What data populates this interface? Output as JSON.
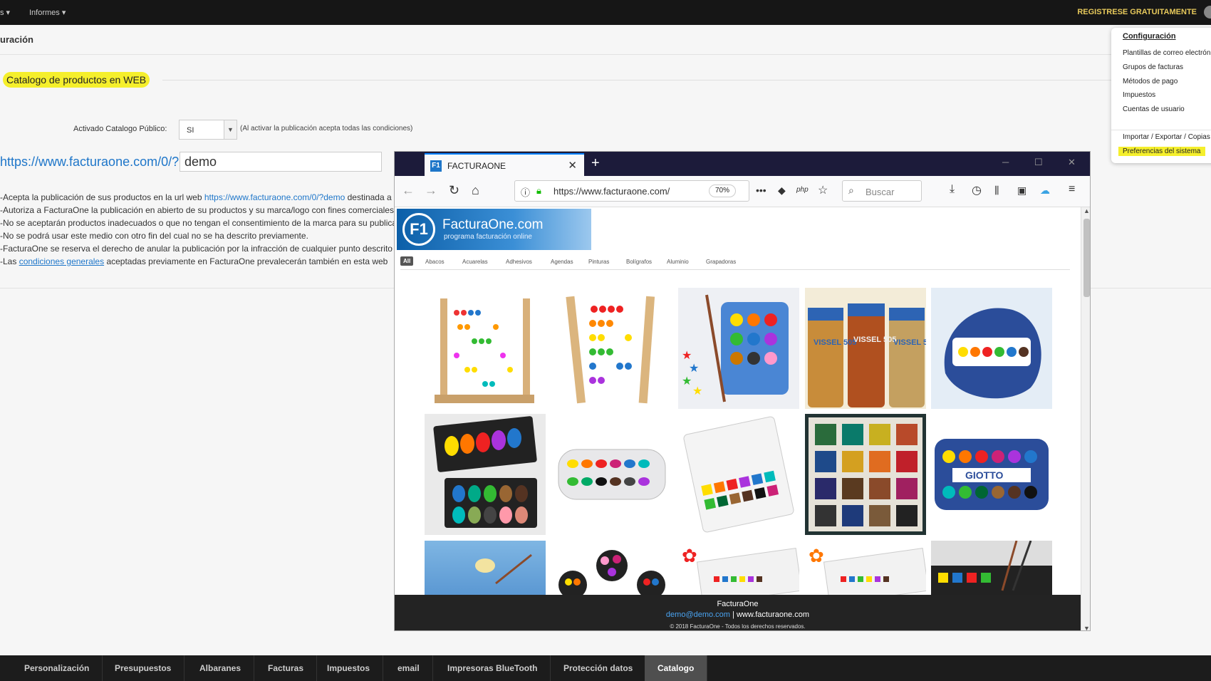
{
  "topbar": {
    "menu_left": "s ▾",
    "menu_informes": "Informes ▾",
    "register": "REGISTRESE GRATUITAMENTE"
  },
  "page": {
    "heading": "uración"
  },
  "catalog": {
    "title": "Catalogo de productos en WEB",
    "activado_label": "Activado Catalogo Público:",
    "activado_value": "SI",
    "activado_note": "(Al activar la publicación acepta todas las condiciones)",
    "url_prefix": "https://www.facturaone.com/0/?",
    "slug": "demo"
  },
  "terms": {
    "l1_pre": "-Acepta la publicación de sus productos en la url web ",
    "l1_link": "https://www.facturaone.com/0/?demo",
    "l1_post": " destinada a la publicación de su catálogo",
    "l2": "-Autoriza a FacturaOne la publicación en abierto de su productos y su marca/logo con fines comerciales",
    "l3": "-No se aceptarán productos inadecuados o que no tengan el consentimiento de la marca para su publicación",
    "l4": "-No se podrá usar este medio con otro fin del cual no se ha descrito previamente.",
    "l5": "-FacturaOne se reserva el derecho de anular la publicación por la infracción de cualquier punto descrito",
    "l6_pre": "-Las ",
    "l6_link": "condiciones generales",
    "l6_post": " aceptadas previamente en FacturaOne prevalecerán también en esta web"
  },
  "dropdown": {
    "header": "Configuración",
    "items": [
      "Plantillas de correo electrónico",
      "Grupos de facturas",
      "Métodos de pago",
      "Impuestos",
      "Cuentas de usuario",
      "Importar / Exportar / Copias",
      "Preferencias del sistema"
    ]
  },
  "browser": {
    "tab_title": "FACTURAONE",
    "url": "https://www.facturaone.com/",
    "zoom": "70%",
    "search_placeholder": "Buscar",
    "php_label": "php"
  },
  "site": {
    "logo_name": "FacturaOne.com",
    "logo_sub": "programa facturación online",
    "logo_mark": "F1",
    "categories": [
      "All",
      "Abacos",
      "Acuarelas",
      "Adhesivos",
      "Agendas",
      "Pinturas",
      "Bolígrafos",
      "Aluminio",
      "Grapadoras"
    ],
    "footer_name": "FacturaOne",
    "footer_email": "demo@demo.com",
    "footer_sep": " | ",
    "footer_web": "www.facturaone.com",
    "footer_copy": "© 2018 FacturaOne - Todos los derechos reservados.",
    "vissel_text": "VISSEL 505",
    "giotto_text": "GIOTTO"
  },
  "bottom_tabs": [
    "Personalización",
    "Presupuestos",
    "Albaranes",
    "Facturas",
    "Impuestos",
    "email",
    "Impresoras BlueTooth",
    "Protección datos",
    "Catalogo"
  ],
  "colors": {
    "highlight": "#f5ef2c",
    "link": "#1e76c9",
    "accent_gold": "#e7c95b",
    "topbar": "#161616"
  }
}
